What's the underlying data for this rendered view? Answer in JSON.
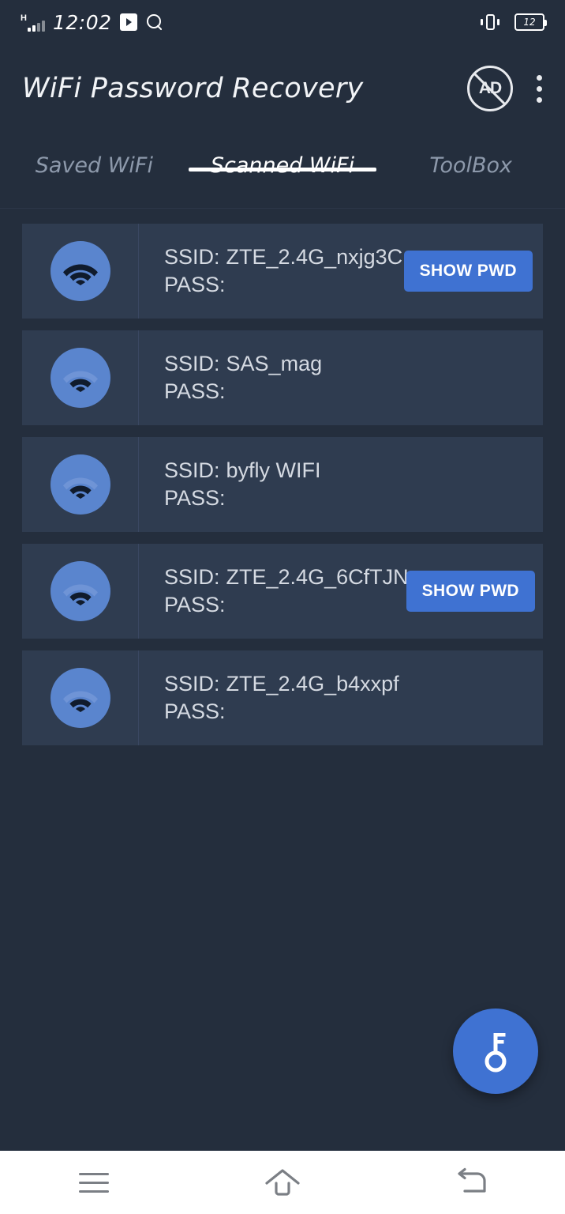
{
  "status_bar": {
    "network_type": "H",
    "time": "12:02",
    "play_icon": "play-icon",
    "search_icon": "search-icon",
    "vibrate_icon": "vibrate-icon",
    "battery_level": "12"
  },
  "app_bar": {
    "title": "WiFi Password Recovery",
    "remove_ads_label": "AD",
    "remove_ads_icon": "no-ads-icon",
    "overflow_icon": "kebab-menu-icon"
  },
  "tabs": [
    {
      "label": "Saved WiFi",
      "active": false
    },
    {
      "label": "Scanned WiFi",
      "active": true
    },
    {
      "label": "ToolBox",
      "active": false
    }
  ],
  "list": {
    "ssid_label": "SSID:",
    "pass_label": "PASS:",
    "show_pwd_label": "SHOW PWD",
    "rows": [
      {
        "ssid": "ZTE_2.4G_nxjg3C",
        "pass": "",
        "signal": 3,
        "has_show_pwd": true
      },
      {
        "ssid": "SAS_mag",
        "pass": "",
        "signal": 2,
        "has_show_pwd": false
      },
      {
        "ssid": "byfly WIFI",
        "pass": "",
        "signal": 2,
        "has_show_pwd": false
      },
      {
        "ssid": "ZTE_2.4G_6CfTJN",
        "pass": "",
        "signal": 2,
        "has_show_pwd": true
      },
      {
        "ssid": "ZTE_2.4G_b4xxpf",
        "pass": "",
        "signal": 2,
        "has_show_pwd": false
      }
    ]
  },
  "fab": {
    "icon": "key-icon"
  },
  "nav_bar": {
    "recents_icon": "menu-icon",
    "home_icon": "home-icon",
    "back_icon": "back-icon"
  },
  "colors": {
    "background": "#242e3d",
    "card": "#2f3c50",
    "accent": "#3f72d2",
    "icon_circle": "#5a85ce",
    "text_primary": "#d5dae2",
    "tab_inactive": "#8d99ab"
  }
}
